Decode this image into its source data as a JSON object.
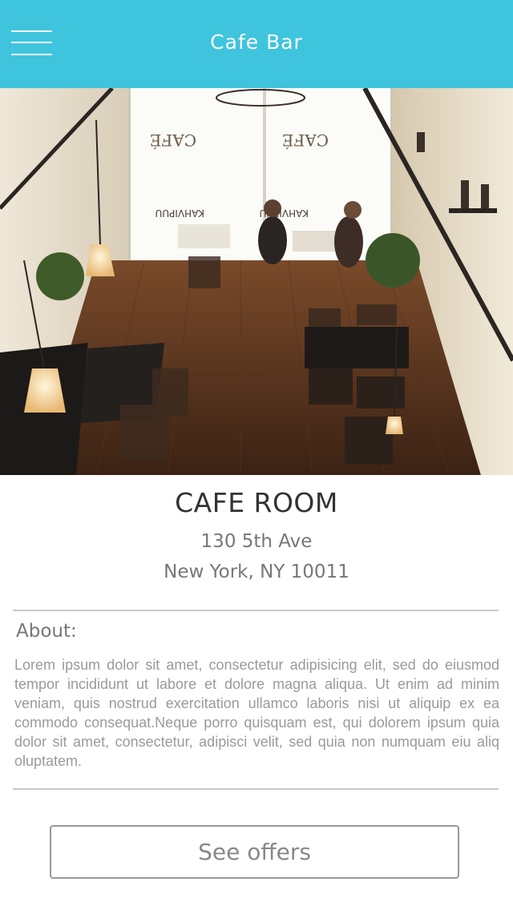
{
  "header": {
    "title": "Cafe Bar",
    "menu_icon": "hamburger-menu-icon",
    "background_color": "#3fc4dd"
  },
  "hero": {
    "image_subject": "cafe interior photo",
    "window_lettering": [
      "CAFÉ",
      "CAFÉ",
      "KAHVIPUU",
      "KAHVIPUU"
    ]
  },
  "venue": {
    "name": "CAFE ROOM",
    "address_line1": "130 5th Ave",
    "address_line2": "New York, NY 10011"
  },
  "about": {
    "title": "About:",
    "text": "Lorem ipsum dolor sit amet, consectetur adipisicing elit, sed do eiusmod tempor incididunt ut labore et dolore magna aliqua. Ut enim ad minim veniam, quis nostrud exercitation ullamco laboris nisi ut aliquip ex ea commodo consequat.Neque porro quisquam est, qui dolorem ipsum quia dolor sit amet, consectetur, adipisci velit, sed quia non numquam eiu aliq oluptatem."
  },
  "actions": {
    "see_offers_label": "See offers"
  }
}
